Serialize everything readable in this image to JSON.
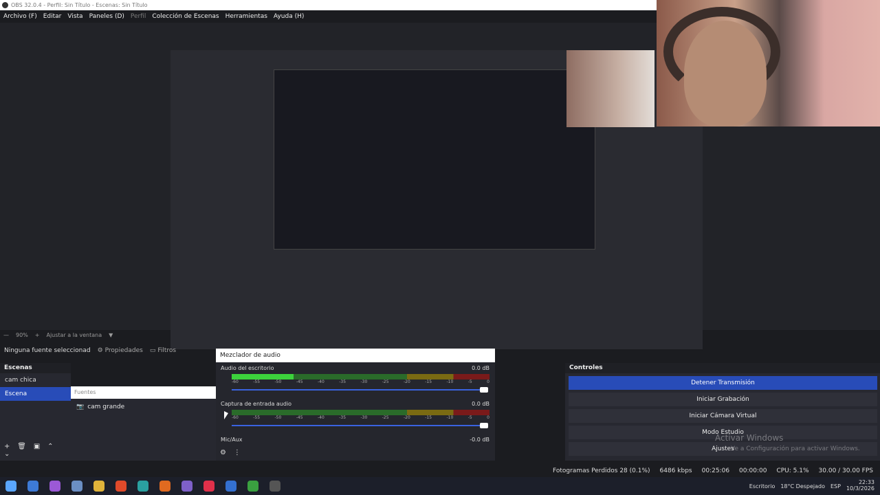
{
  "window": {
    "title": "OBS 32.0.4 - Perfil: Sin Título - Escenas: Sin Título"
  },
  "menu": {
    "items": [
      "Archivo (F)",
      "Editar",
      "Vista",
      "Paneles (D)",
      "Perfil",
      "Colección de Escenas",
      "Herramientas",
      "Ayuda (H)"
    ],
    "disabled_index": 4
  },
  "zoom": {
    "value": "90%",
    "fit_label": "Ajustar a la ventana"
  },
  "source_toolbar": {
    "no_source": "Ninguna fuente seleccionad",
    "properties": "Propiedades",
    "filters": "Filtros"
  },
  "scenes": {
    "title": "Escenas",
    "items": [
      "cam chica",
      "Escena"
    ],
    "active_index": 1
  },
  "sources": {
    "header": "Fuentes",
    "items": [
      "cam grande"
    ]
  },
  "mixer": {
    "title": "Mezclador de audio",
    "channels": [
      {
        "name": "Audio del escritorio",
        "db": "0.0 dB",
        "level": 0.24
      },
      {
        "name": "Captura de entrada audio",
        "db": "0.0 dB",
        "level": 0.0
      },
      {
        "name": "Mic/Aux",
        "db": "-0.0 dB",
        "level": 0.0
      }
    ],
    "ticks": [
      "-60",
      "-55",
      "-50",
      "-45",
      "-40",
      "-35",
      "-30",
      "-25",
      "-20",
      "-15",
      "-10",
      "-5",
      "0"
    ]
  },
  "controls": {
    "title": "Controles",
    "stop_stream": "Detener Transmisión",
    "start_record": "Iniciar Grabación",
    "start_vcam": "Iniciar Cámara Virtual",
    "studio_mode": "Modo Estudio",
    "settings": "Ajustes"
  },
  "status": {
    "dropped": "Fotogramas Perdidos 28 (0.1%)",
    "bitrate": "6486 kbps",
    "stream_time": "00:25:06",
    "record_time": "00:00:00",
    "cpu": "CPU: 5.1%",
    "fps": "30.00 / 30.00 FPS"
  },
  "watermark": {
    "line1": "Activar Windows",
    "line2": "Ve a Configuración para activar Windows."
  },
  "taskbar": {
    "desktop_label": "Escritorio",
    "weather": "18°C  Despejado",
    "lang": "ESP",
    "time": "22:33",
    "date": "10/3/2026"
  },
  "colors": {
    "accent": "#284cb8",
    "meter_green": "#3cd23c"
  }
}
